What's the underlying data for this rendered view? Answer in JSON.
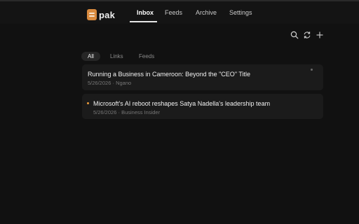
{
  "app": {
    "name": "pak"
  },
  "nav": {
    "tabs": [
      {
        "label": "Inbox",
        "active": true
      },
      {
        "label": "Feeds",
        "active": false
      },
      {
        "label": "Archive",
        "active": false
      },
      {
        "label": "Settings",
        "active": false
      }
    ]
  },
  "toolbar": {
    "icons": [
      "search-icon",
      "refresh-icon",
      "plus-icon"
    ]
  },
  "filters": {
    "items": [
      {
        "label": "All",
        "active": true
      },
      {
        "label": "Links",
        "active": false
      },
      {
        "label": "Feeds",
        "active": false
      }
    ]
  },
  "articles": [
    {
      "title": "Running a Business in Cameroon: Beyond the \"CEO\" Title",
      "date": "5/26/2026",
      "separator": "·",
      "source": "Ngano",
      "unread": false
    },
    {
      "title": "Microsoft's AI reboot reshapes Satya Nadella's leadership team",
      "date": "5/26/2026",
      "separator": "·",
      "source": "Business Insider",
      "unread": true
    }
  ],
  "colors": {
    "background": "#111111",
    "card": "#1b1b1b",
    "accent": "#d88a3e",
    "unread_dot": "#e89a3c"
  }
}
